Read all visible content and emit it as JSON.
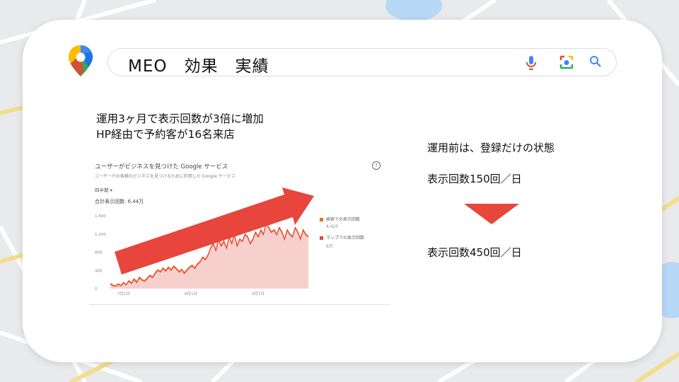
{
  "search": {
    "query": "MEO　効果　実績"
  },
  "icons": {
    "maps_pin": "google-maps-pin-icon",
    "mic": "microphone-icon",
    "camera": "lens-camera-icon",
    "search": "magnifier-icon"
  },
  "headline": {
    "line1": "運用3ヶ月で表示回数が3倍に増加",
    "line2": "HP経由で予約客が16名来店"
  },
  "panel": {
    "title": "ユーザーがビジネスを見つけた Google サービス",
    "subtitle": "ユーザーがお客様のビジネスを見つけるために利用した Google サービス",
    "period": "四半期 ▾",
    "total": "合計表示回数: 6.44万",
    "help": "?"
  },
  "chart_data": {
    "type": "area",
    "yticks": [
      "1,600",
      "1,200",
      "800",
      "400",
      "0"
    ],
    "xticks": [
      "7月1日",
      "8月1日",
      "9月1日"
    ],
    "ylim": [
      0,
      1600
    ],
    "series": [
      {
        "name": "検索での表示回数",
        "total": "4,420",
        "color": "#e8711a",
        "values": [
          120,
          80,
          60,
          110,
          70,
          140,
          90,
          180,
          130,
          220,
          150,
          260,
          200,
          180,
          240,
          300,
          260,
          350,
          420,
          380,
          460,
          400,
          480,
          420,
          500,
          450,
          380,
          430,
          350,
          420,
          480,
          520,
          460,
          550,
          600,
          700,
          650,
          750,
          900,
          1000,
          850,
          1100,
          950,
          1050,
          900,
          1150,
          1000,
          1200,
          950,
          1100,
          1050,
          1200,
          1150,
          1000,
          1100,
          1250,
          1150,
          1300,
          1200,
          1450,
          1350,
          1250,
          1300,
          1200,
          1350,
          1250,
          1100,
          1300,
          1200,
          1150,
          1350,
          1250,
          1100,
          1300,
          1200,
          1150
        ]
      },
      {
        "name": "マップでの表示回数",
        "total": "6万",
        "color": "#e8453c",
        "values": [
          100,
          60,
          50,
          90,
          60,
          120,
          80,
          160,
          110,
          200,
          130,
          240,
          180,
          160,
          220,
          280,
          240,
          330,
          400,
          360,
          440,
          380,
          460,
          400,
          480,
          430,
          360,
          410,
          330,
          400,
          460,
          500,
          440,
          530,
          580,
          680,
          630,
          730,
          880,
          980,
          830,
          1080,
          930,
          1030,
          880,
          1130,
          980,
          1180,
          930,
          1080,
          1030,
          1180,
          1130,
          980,
          1080,
          1230,
          1130,
          1280,
          1180,
          1430,
          1330,
          1230,
          1280,
          1180,
          1330,
          1230,
          1080,
          1280,
          1180,
          1130,
          1330,
          1230,
          1080,
          1280,
          1180,
          1130
        ]
      }
    ],
    "annotation": "upward-trend-arrow"
  },
  "right": {
    "before_label": "運用前は、登録だけの状態",
    "before_value": "表示回数150回／日",
    "after_value": "表示回数450回／日"
  },
  "colors": {
    "accent_red": "#e8453c",
    "map_bg": "#e9eaec",
    "road": "#ffffff",
    "road_yellow": "#f4dd8a",
    "water": "#b7d8f6"
  }
}
